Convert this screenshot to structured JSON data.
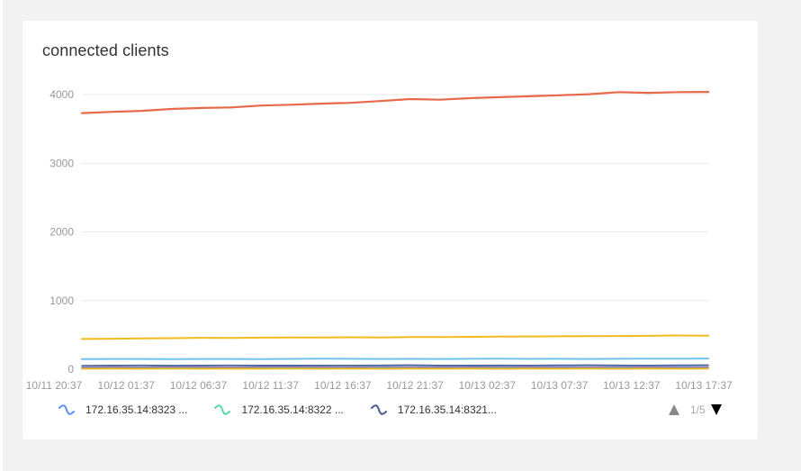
{
  "card": {
    "title": "connected clients"
  },
  "colors": {
    "background": "#f2f2f2",
    "card": "#ffffff",
    "grid": "#e8e8e8",
    "axis_text": "#999999"
  },
  "chart_data": {
    "type": "line",
    "title": "connected clients",
    "xlabel": "",
    "ylabel": "",
    "ylim": [
      0,
      4000
    ],
    "y_ticks": [
      0,
      1000,
      2000,
      3000,
      4000
    ],
    "x_tick_labels": [
      "10/11 20:37",
      "10/12 01:37",
      "10/12 06:37",
      "10/12 11:37",
      "10/12 16:37",
      "10/12 21:37",
      "10/13 02:37",
      "10/13 07:37",
      "10/13 12:37",
      "10/13 17:37"
    ],
    "grid": true,
    "legend_position": "bottom",
    "series": [
      {
        "color": "#e8694a",
        "width": 2.2,
        "values": [
          3730,
          3748,
          3762,
          3790,
          3805,
          3812,
          3840,
          3852,
          3868,
          3880,
          3905,
          3935,
          3925,
          3948,
          3962,
          3975,
          3990,
          4005,
          4035,
          4025,
          4035,
          4038
        ]
      },
      {
        "color": "#f2bb1d",
        "width": 2,
        "values": [
          440,
          445,
          448,
          452,
          458,
          455,
          460,
          462,
          462,
          465,
          462,
          468,
          470,
          472,
          475,
          478,
          480,
          482,
          484,
          486,
          492,
          488
        ]
      },
      {
        "color": "#6fc3ec",
        "width": 2,
        "values": [
          148,
          150,
          149,
          147,
          150,
          149,
          148,
          151,
          153,
          152,
          150,
          151,
          150,
          152,
          153,
          151,
          152,
          150,
          152,
          153,
          154,
          156
        ]
      },
      {
        "name": "172.16.35.14:8321...",
        "color": "#4a5b8c",
        "width": 1.5,
        "values": [
          52,
          55,
          58,
          54,
          56,
          58,
          55,
          57,
          56,
          55,
          58,
          60,
          57,
          56,
          58,
          57,
          59,
          60,
          58,
          57,
          59,
          60
        ]
      },
      {
        "name": "172.16.35.14:8323 ...",
        "color": "#5b8ff9",
        "width": 1.5,
        "values": [
          32,
          34,
          33,
          35,
          34,
          33,
          36,
          35,
          34,
          33,
          35,
          36,
          34,
          35,
          36,
          34,
          35,
          36,
          35,
          34,
          35,
          36
        ]
      },
      {
        "color": "#e8694a",
        "width": 1.5,
        "values": [
          20,
          22,
          21,
          23,
          22,
          21,
          22,
          23,
          22,
          21,
          23,
          22,
          21,
          22,
          23,
          22,
          21,
          22,
          23,
          22,
          21,
          22
        ]
      },
      {
        "name": "172.16.35.14:8322 ...",
        "color": "#5ad8a6",
        "width": 1.5,
        "values": [
          10,
          12,
          11,
          13,
          12,
          11,
          12,
          13,
          12,
          11,
          13,
          12,
          11,
          12,
          13,
          12,
          11,
          12,
          13,
          12,
          11,
          12
        ]
      },
      {
        "color": "#f2bb1d",
        "width": 1.5,
        "values": [
          5,
          6,
          5,
          6,
          5,
          6,
          5,
          6,
          5,
          6,
          5,
          6,
          5,
          6,
          5,
          6,
          5,
          6,
          5,
          6,
          5,
          6
        ]
      }
    ]
  },
  "legend": {
    "items": [
      {
        "label": "172.16.35.14:8323 ...",
        "color": "#5b8ff9"
      },
      {
        "label": "172.16.35.14:8322 ...",
        "color": "#5ad8a6"
      },
      {
        "label": "172.16.35.14:8321...",
        "color": "#4a5b8c"
      }
    ],
    "pager": {
      "text": "1/5",
      "up_icon": "triangle-up",
      "down_icon": "triangle-down"
    }
  }
}
